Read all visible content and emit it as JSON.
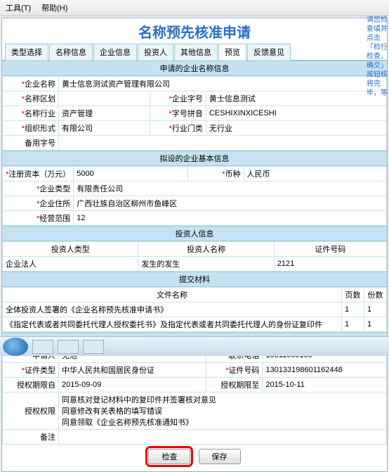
{
  "menu": {
    "tools": "工具(T)",
    "help": "帮助(H)"
  },
  "page_title": "名称预先核准申请",
  "tabs": [
    "类型选择",
    "名称信息",
    "企业信息",
    "投资人",
    "其他信息",
    "预览",
    "反馈意见"
  ],
  "active_tab": 5,
  "sec1": {
    "hdr": "申请的企业名称信息",
    "name_lbl": "企业名称",
    "name": "黄士信息测试资产管理有限公司",
    "region_lbl": "名称区划",
    "region": "",
    "zihao_lbl": "企业字号",
    "zihao": "黄士信息测试",
    "industry_lbl": "名称行业",
    "industry": "资产管理",
    "pinyin_lbl": "字号拼音",
    "pinyin": "CESHIXINXICESHI",
    "orgform_lbl": "组织形式",
    "orgform": "有限公司",
    "hyml_lbl": "行业门类",
    "hyml": "无行业",
    "byzh_lbl": "备用字号"
  },
  "sec2": {
    "hdr": "拟设的企业基本信息",
    "capital_lbl": "注册资本（万元）",
    "capital": "5000",
    "currency_lbl": "币种",
    "currency": "人民币",
    "type_lbl": "企业类型",
    "type": "有限责任公司",
    "addr_lbl": "企业住所",
    "addr": "广西壮族自治区柳州市鱼峰区",
    "scope_lbl": "经营范围",
    "scope": "12"
  },
  "sec3": {
    "hdr": "投资人信息",
    "h1": "投资人类型",
    "h2": "投资人名称",
    "h3": "证件号码",
    "r1c1": "企业法人",
    "r1c2": "发生的发生",
    "r1c3": "2121"
  },
  "sec4": {
    "hdr": "提交材料",
    "h1": "文件名称",
    "h2": "页数",
    "h3": "份数",
    "r1": "全体投资人签署的《企业名称预先核准申请书》",
    "r1p": "1",
    "r1c": "1",
    "r2": "《指定代表或者共同委托代理人授权委托书》及指定代表或者共同委托代理人的身份证复印件",
    "r2p": "1",
    "r2c": "1"
  },
  "sec5": {
    "hdr": "指定代表或委托代理人信息",
    "applicant_lbl": "申请人",
    "applicant": "无池",
    "phone_lbl": "联系电话",
    "phone": "15811060130",
    "idtype_lbl": "证件类型",
    "idtype": "中华人民共和国居民身份证",
    "idno_lbl": "证件号码",
    "idno": "130133198601162448",
    "sdate_lbl": "授权期限自",
    "sdate": "2015-09-09",
    "edate_lbl": "授权期限至",
    "edate": "2015-10-11",
    "auth_lbl": "授权权限",
    "auth1": "同意核对登记材料中的复印件并签署核对意见",
    "auth2": "同意修改有关表格的填写错误",
    "auth3": "同意领取《企业名称预先核准通知书》",
    "remark_lbl": "备注"
  },
  "buttons": {
    "submit": "检查",
    "save": "保存"
  },
  "sidenote": "请您检查填并点击「检行检查，确交」按钮核将完毕，等"
}
